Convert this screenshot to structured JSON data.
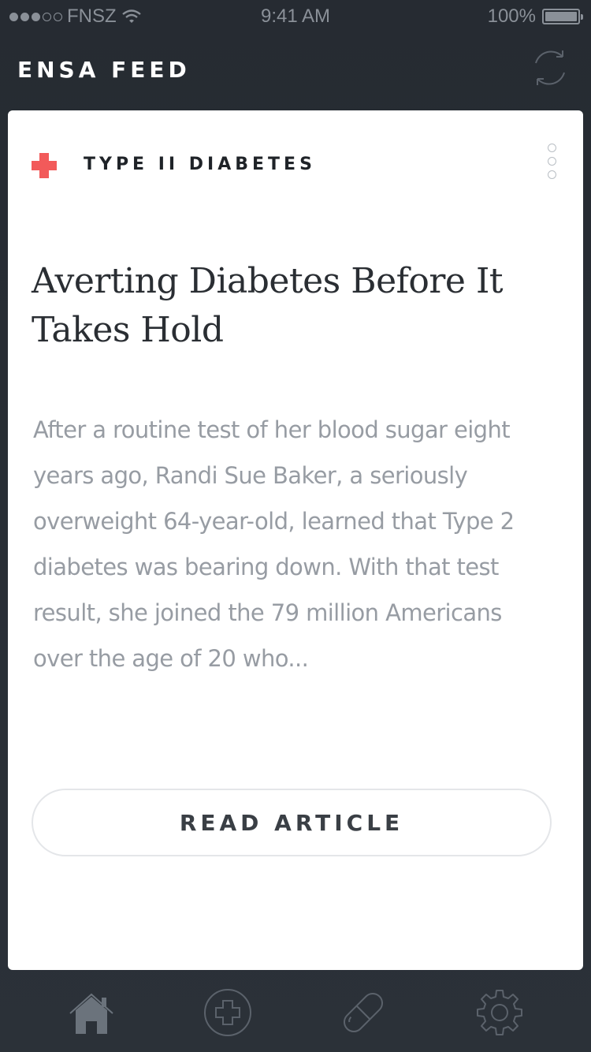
{
  "status_bar": {
    "carrier": "FNSZ",
    "time": "9:41 AM",
    "battery": "100%",
    "signal_bars_filled": 3,
    "signal_bars_total": 5
  },
  "nav": {
    "title": "ENSA FEED",
    "refresh_icon": "refresh-icon"
  },
  "card": {
    "category": "TYPE II DIABETES",
    "category_icon": "medical-cross-icon",
    "headline": "Averting Diabetes Before It Takes Hold",
    "excerpt": "After a routine test of her blood sugar eight years ago, Randi Sue Baker, a seriously overweight 64-year-old, learned that Type 2 diabetes was bearing down. With that test result, she joined the 79 million Americans over the age of 20 who...",
    "cta": "READ ARTICLE"
  },
  "tab_bar": {
    "tabs": [
      {
        "name": "home",
        "icon": "home-icon",
        "active": true
      },
      {
        "name": "health",
        "icon": "medical-plus-icon",
        "active": false
      },
      {
        "name": "medication",
        "icon": "pill-icon",
        "active": false
      },
      {
        "name": "settings",
        "icon": "gear-icon",
        "active": false
      }
    ]
  },
  "colors": {
    "background": "#262c33",
    "accent": "#f25a5a",
    "card": "#ffffff",
    "excerpt_text": "#979ca3"
  }
}
